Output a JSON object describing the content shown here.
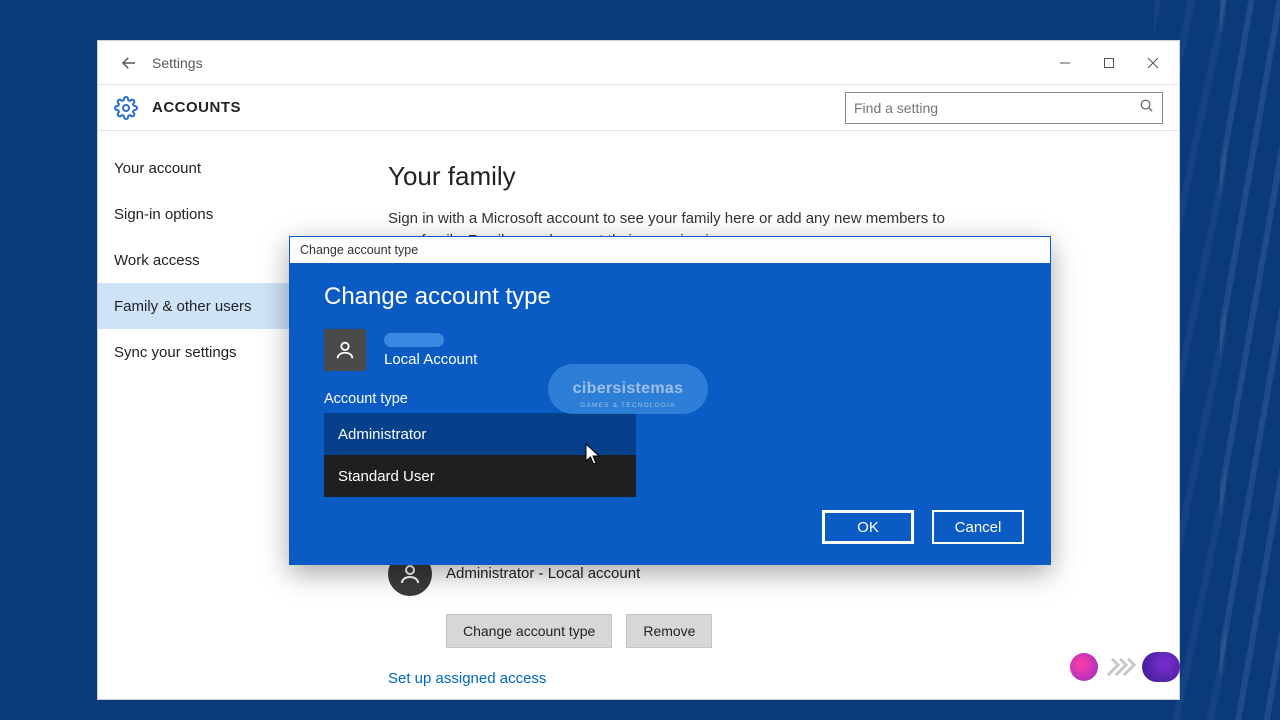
{
  "window": {
    "title": "Settings"
  },
  "header": {
    "section_title": "ACCOUNTS",
    "search_placeholder": "Find a setting"
  },
  "sidebar": {
    "items": [
      {
        "label": "Your account"
      },
      {
        "label": "Sign-in options"
      },
      {
        "label": "Work access"
      },
      {
        "label": "Family & other users"
      },
      {
        "label": "Sync your settings"
      }
    ],
    "selected_index": 3
  },
  "main": {
    "heading": "Your family",
    "description": "Sign in with a Microsoft account to see your family here or add any new members to your family. Family members get their own sign-in",
    "user_role_line": "Administrator - Local account",
    "button_change": "Change account type",
    "button_remove": "Remove",
    "link_assigned": "Set up assigned access"
  },
  "dialog": {
    "titlebar": "Change account type",
    "heading": "Change account type",
    "account_sub": "Local Account",
    "section_label": "Account type",
    "options": [
      {
        "label": "Administrator"
      },
      {
        "label": "Standard User"
      }
    ],
    "hover_index": 0,
    "ok_label": "OK",
    "cancel_label": "Cancel"
  },
  "watermark": {
    "text": "cibersistemas",
    "sub": "GAMES & TECNOLOGIA"
  }
}
